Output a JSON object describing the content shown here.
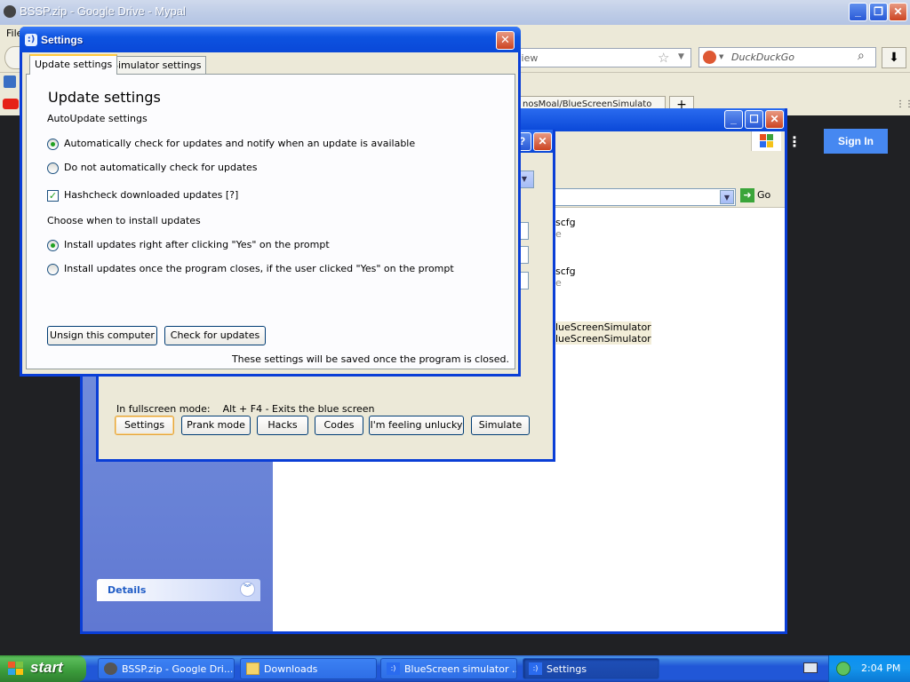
{
  "browser": {
    "title": "BSSP.zip - Google Drive - Mypal",
    "menu_first": "File",
    "url_fragment": "view",
    "search_placeholder": "DuckDuckGo",
    "tab_label": "nosMoal/BlueScreenSimulato",
    "new_tab": "+",
    "signin_label": "Sign In"
  },
  "explorer": {
    "go_label": "Go",
    "details_label": "Details",
    "files": [
      {
        "name": "scfg",
        "sub": "e"
      },
      {
        "name": "scfg",
        "sub": "e"
      }
    ],
    "highlighted": [
      "lueScreenSimulator",
      "lueScreenSimulator"
    ]
  },
  "bss": {
    "fullscreen_label": "In fullscreen mode:",
    "fullscreen_hint": "Alt + F4 - Exits the blue screen",
    "buttons": {
      "settings": "Settings",
      "prank_mode": "Prank mode",
      "hacks": "Hacks",
      "codes": "Codes",
      "feeling_unlucky": "I'm feeling unlucky",
      "simulate": "Simulate"
    }
  },
  "settings": {
    "title": "Settings",
    "tabs": [
      "Update settings",
      "Simulator settings"
    ],
    "heading": "Update settings",
    "autoupdate_label": "AutoUpdate settings",
    "radio_auto_check": "Automatically check for updates and notify when an update is available",
    "radio_no_check": "Do not automatically check for updates",
    "checkbox_hashcheck": "Hashcheck downloaded updates [?]",
    "install_label": "Choose when to install updates",
    "radio_install_now": "Install updates right after clicking \"Yes\" on the prompt",
    "radio_install_close": "Install updates once the program closes, if the user clicked \"Yes\" on the prompt",
    "unsign_button": "Unsign this computer",
    "check_button": "Check for updates",
    "saved_note": "These settings will be saved once the program is closed.",
    "state": {
      "auto_check": true,
      "hashcheck": true,
      "install_now": true
    }
  },
  "taskbar": {
    "start_label": "start",
    "items": [
      {
        "label": "BSSP.zip - Google Dri...",
        "active": false
      },
      {
        "label": "Downloads",
        "active": false
      },
      {
        "label": "BlueScreen simulator ...",
        "active": false
      },
      {
        "label": "Settings",
        "active": true
      }
    ],
    "clock": "2:04 PM"
  },
  "colors": {
    "xp_blue": "#0a48d8",
    "xp_green": "#21a121",
    "signin_blue": "#4688f1"
  }
}
